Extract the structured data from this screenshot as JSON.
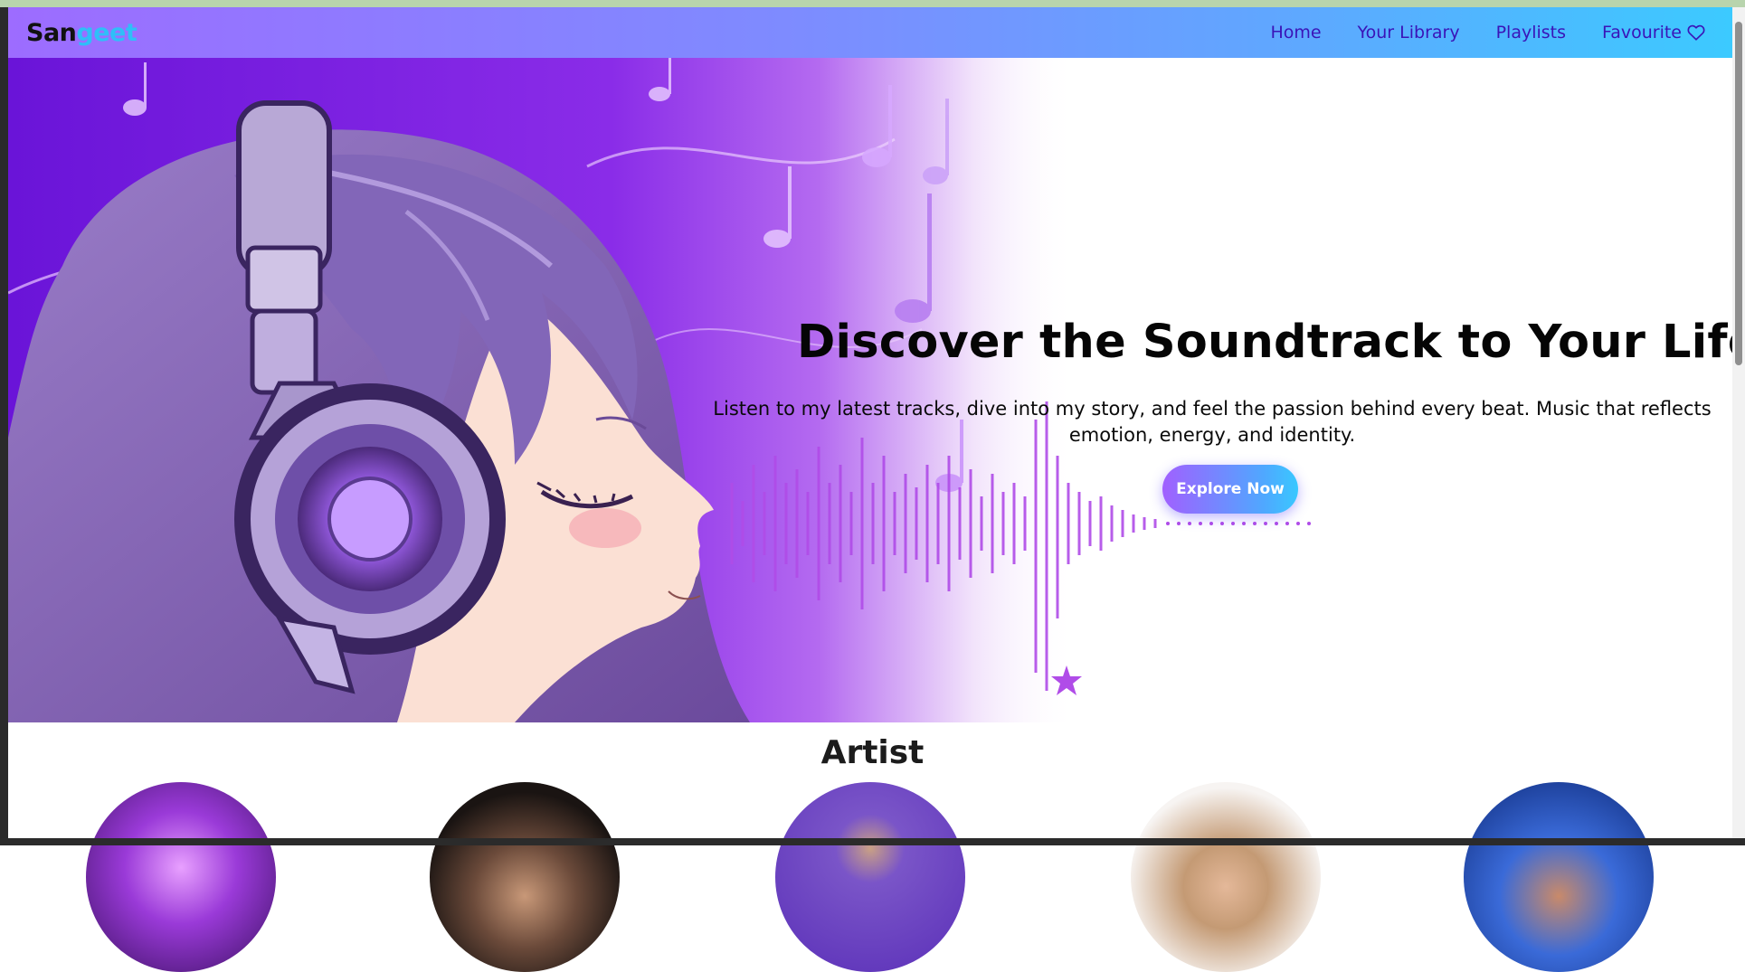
{
  "brand": {
    "name_part1": "San",
    "name_part2": "geet"
  },
  "nav": {
    "links": [
      {
        "label": "Home"
      },
      {
        "label": "Your Library"
      },
      {
        "label": "Playlists"
      },
      {
        "label": "Favourite",
        "icon": "heart-icon"
      }
    ]
  },
  "hero": {
    "title": "Discover the Soundtrack to Your Life",
    "subtitle": "Listen to my latest tracks, dive into my story, and feel the passion behind every beat. Music that reflects emotion, energy, and identity.",
    "cta_label": "Explore Now"
  },
  "artist_section": {
    "title": "Artist"
  },
  "colors": {
    "nav_gradient_start": "#9d6cff",
    "nav_gradient_end": "#3ccaff",
    "nav_link": "#3a14b8",
    "logo_accent": "#2fbff8",
    "hero_purple": "#7b2bd8"
  }
}
